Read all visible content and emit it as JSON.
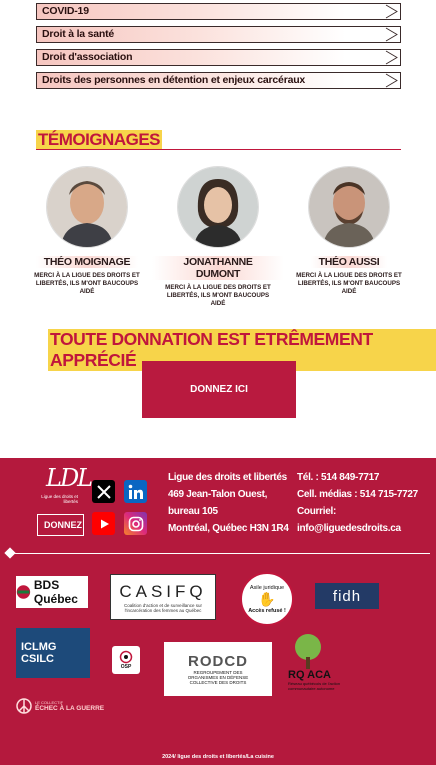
{
  "topics": [
    {
      "label": "COVID-19"
    },
    {
      "label": "Droit à la santé"
    },
    {
      "label": "Droit d'association"
    },
    {
      "label": "Droits des personnes en détention et enjeux carcéraux"
    }
  ],
  "testimonials": {
    "title": "TÉMOIGNAGES",
    "items": [
      {
        "name": "THÉO MOIGNAGE",
        "role": "MERCI À LA LIGUE DES DROITS ET LIBERTÉS, ILS M'ONT BAUCOUPS AIDÉ"
      },
      {
        "name": "JONATHANNE DUMONT",
        "role": "MERCI À LA LIGUE DES DROITS ET LIBERTÉS, ILS M'ONT BAUCOUPS AIDÉ"
      },
      {
        "name": "THÉO AUSSI",
        "role": "MERCI À LA LIGUE DES DROITS ET LIBERTÉS, ILS M'ONT BAUCOUPS AIDÉ"
      }
    ]
  },
  "donation": {
    "title": "TOUTE DONNATION EST ETRÊMEMENT APPRÉCIÉ",
    "button": "DONNEZ ICI"
  },
  "footer": {
    "logo_mark": "LDL",
    "logo_sub": "Ligue des droits et libertés",
    "donner_button": "DONNEZ",
    "address": [
      "Ligue des droits et libertés",
      "469 Jean-Talon Ouest,",
      "bureau 105",
      "Montréal, Québec H3N 1R4"
    ],
    "contact": [
      "Tél. : 514 849-7717",
      "Cell. médias : 514 715-7727",
      "Courriel:",
      "info@liguedesdroits.ca"
    ],
    "partners": {
      "bds": "BDS Québec",
      "casifq_name": "CASIFQ",
      "casifq_sub": "Coalition d'action et de surveillance sur l'incarcération des femmes au Québec",
      "asile_top": "Asile juridique",
      "asile_bottom": "Accès refusé !",
      "fidh": "fidh",
      "iclmg_1": "ICLMG",
      "iclmg_2": "CSILC",
      "osp": "OSP",
      "rodcd": "RODCD",
      "rodcd_sub": "REGROUPEMENT DES ORGANISMES EN DÉFENSE COLLECTIVE DES DROITS",
      "rq_aca": "RQ ACA",
      "rq_aca_sub": "Réseau québécois de l'action communautaire autonome",
      "echec": "ÉCHEC À LA GUERRE",
      "echec_small": "LE COLLECTIF"
    },
    "copyright": "2024/ ligue des droits et libertés/La cuisine"
  },
  "colors": {
    "brand": "#b4193d",
    "accent": "#c0163c",
    "highlight": "#f7d44a"
  }
}
